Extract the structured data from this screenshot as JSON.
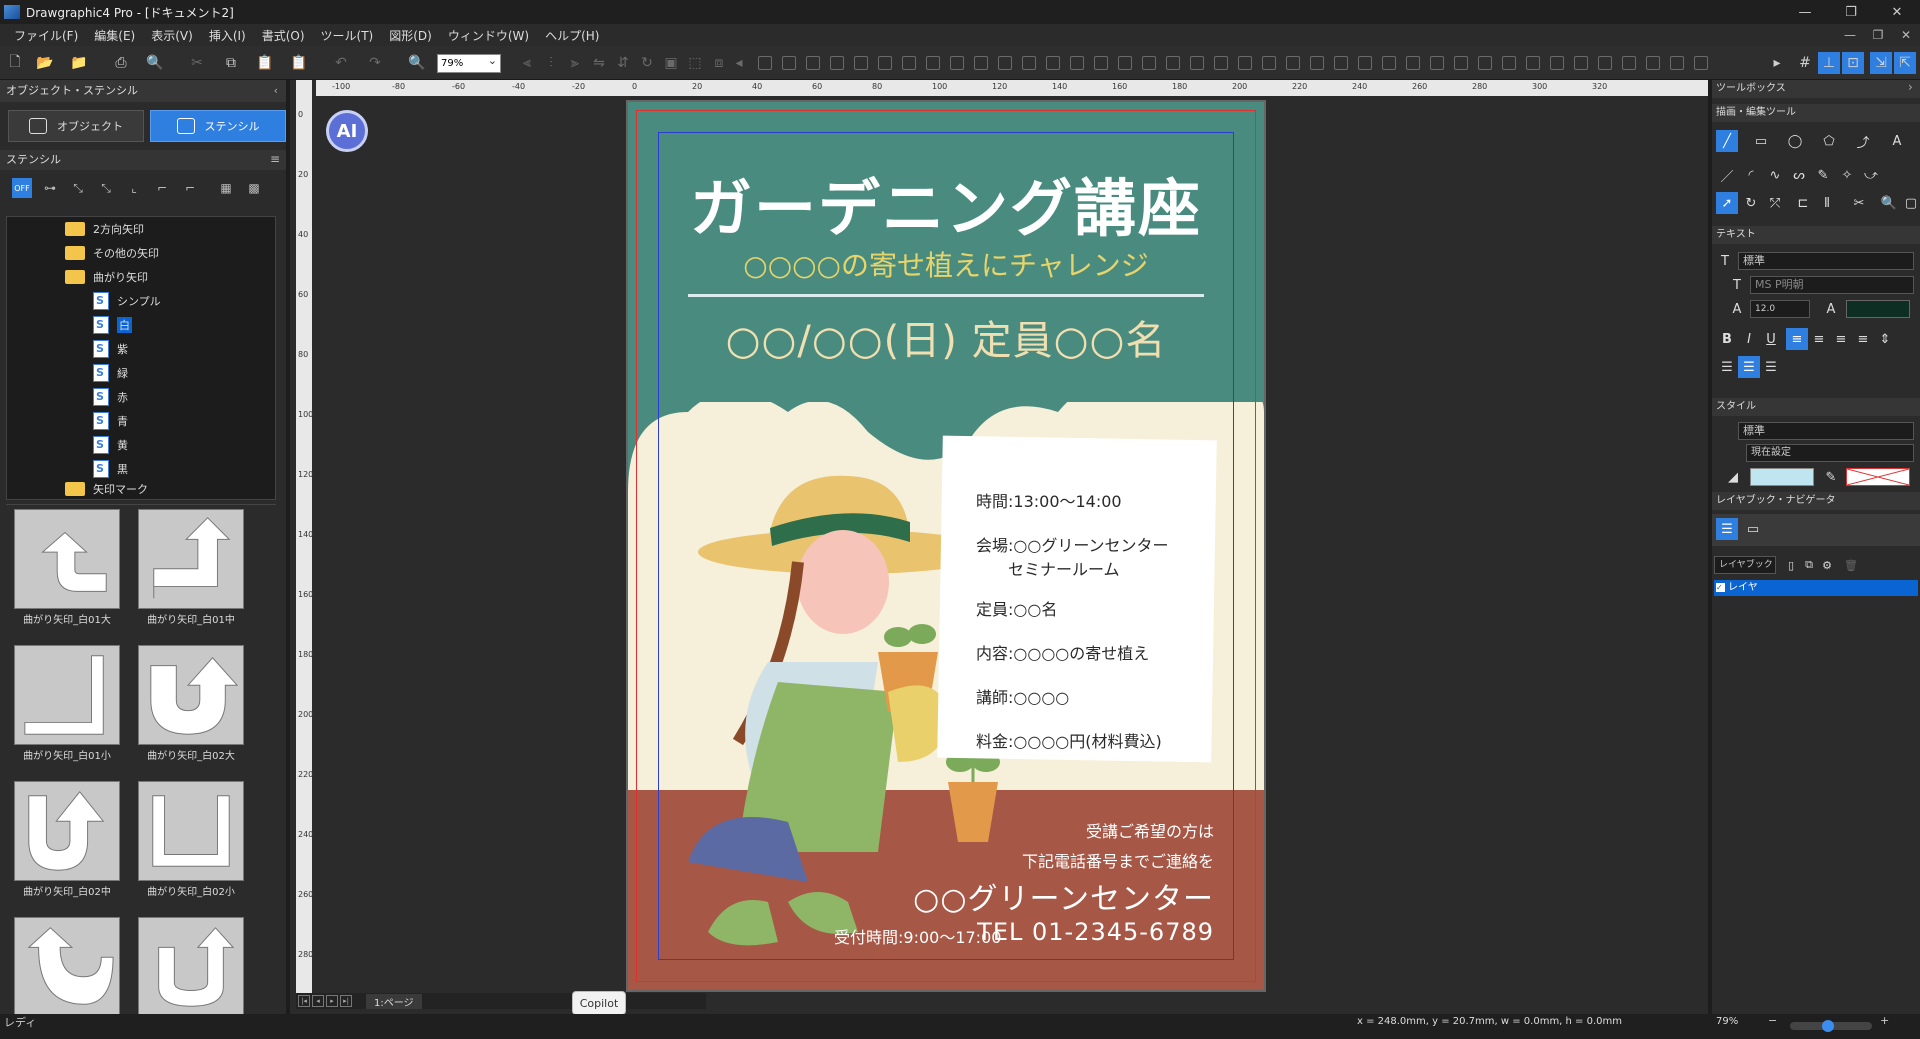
{
  "window": {
    "title": "Drawgraphic4 Pro - [ドキュメント2]",
    "buttons": [
      "—",
      "❐",
      "✕"
    ],
    "mdi_buttons": [
      "—",
      "❐",
      "✕"
    ]
  },
  "menu": [
    "ファイル(F)",
    "編集(E)",
    "表示(V)",
    "挿入(I)",
    "書式(O)",
    "ツール(T)",
    "図形(D)",
    "ウィンドウ(W)",
    "ヘルプ(H)"
  ],
  "toolbar": {
    "zoom": "79%"
  },
  "left_panel": {
    "title": "オブジェクト・ステンシル",
    "tabs": [
      "オブジェクト",
      "ステンシル"
    ],
    "stencil_header": "ステンシル",
    "off_label": "OFF",
    "tree": [
      {
        "label": "2方向矢印",
        "type": "folder"
      },
      {
        "label": "その他の矢印",
        "type": "folder"
      },
      {
        "label": "曲がり矢印",
        "type": "folder"
      },
      {
        "label": "シンプル",
        "type": "stencil"
      },
      {
        "label": "白",
        "type": "stencil",
        "selected": true
      },
      {
        "label": "紫",
        "type": "stencil"
      },
      {
        "label": "緑",
        "type": "stencil"
      },
      {
        "label": "赤",
        "type": "stencil"
      },
      {
        "label": "青",
        "type": "stencil"
      },
      {
        "label": "黄",
        "type": "stencil"
      },
      {
        "label": "黒",
        "type": "stencil"
      },
      {
        "label": "矢印マーク",
        "type": "folder"
      }
    ],
    "thumbnails": [
      "曲がり矢印_白01大",
      "曲がり矢印_白01中",
      "曲がり矢印_白01小",
      "曲がり矢印_白02大",
      "曲がり矢印_白02中",
      "曲がり矢印_白02小",
      "",
      ""
    ]
  },
  "ruler": {
    "h": [
      "-100",
      "-80",
      "-60",
      "-40",
      "-20",
      "0",
      "20",
      "40",
      "60",
      "80",
      "100",
      "120",
      "140",
      "160",
      "180",
      "200",
      "220",
      "240",
      "260",
      "280",
      "300",
      "320"
    ],
    "v": [
      "0",
      "20",
      "40",
      "60",
      "80",
      "100",
      "120",
      "140",
      "160",
      "180",
      "200",
      "220",
      "240",
      "260",
      "280"
    ]
  },
  "ai_button": "AI",
  "poster": {
    "title": "ガーデニング講座",
    "subtitle": "○○○○の寄せ植えにチャレンジ",
    "date": "○○/○○(日) 定員○○名",
    "info": [
      "時間:13:00〜14:00",
      "会場:○○グリーンセンター\n　　セミナールーム",
      "定員:○○名",
      "内容:○○○○の寄せ植え",
      "講師:○○○○",
      "料金:○○○○円(材料費込)"
    ],
    "footer_line1": "受講ご希望の方は",
    "footer_line2": "下記電話番号までご連絡を",
    "center_name": "○○グリーンセンター",
    "hours": "受付時間:9:00〜17:00",
    "tel": "TEL 01-2345-6789",
    "colors": {
      "top": "#4a8b7f",
      "cream": "#f6efd9",
      "bottom": "#a65746"
    }
  },
  "page_tab": "1:ページ",
  "copilot": "Copilot",
  "status": {
    "ready": "レディ",
    "coords": "x = 248.0mm, y = 20.7mm, w = 0.0mm, h = 0.0mm",
    "zoom": "79%"
  },
  "right_panel": {
    "title": "ツールボックス",
    "draw_section": "描画・編集ツール",
    "text_section": "テキスト",
    "text_style": "標準",
    "font": "MS P明朝",
    "font_size": "12.0",
    "style_section": "スタイル",
    "style_value": "標準",
    "line_setting": "現在設定",
    "layer_section": "レイヤブック・ナビゲータ",
    "layerbook_label": "レイヤブック",
    "layer_name": "レイヤ"
  }
}
